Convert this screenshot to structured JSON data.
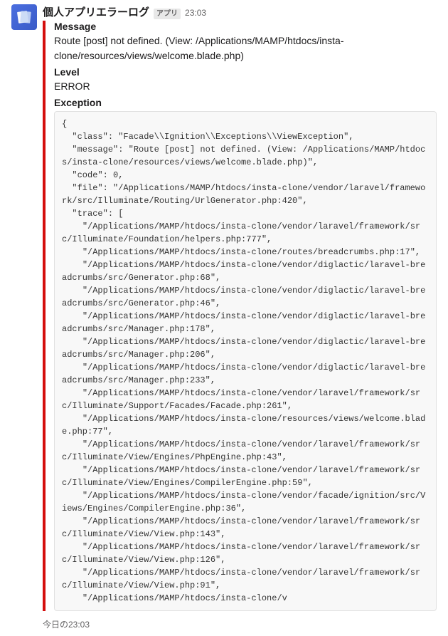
{
  "header": {
    "app_name": "個人アプリエラーログ",
    "app_badge": "アプリ",
    "timestamp": "23:03"
  },
  "attachment": {
    "fields": {
      "message": {
        "label": "Message",
        "value": "Route [post] not defined. (View: /Applications/MAMP/htdocs/insta-clone/resources/views/welcome.blade.php)"
      },
      "level": {
        "label": "Level",
        "value": "ERROR"
      },
      "exception": {
        "label": "Exception",
        "code": "{\n  \"class\": \"Facade\\\\Ignition\\\\Exceptions\\\\ViewException\",\n  \"message\": \"Route [post] not defined. (View: /Applications/MAMP/htdocs/insta-clone/resources/views/welcome.blade.php)\",\n  \"code\": 0,\n  \"file\": \"/Applications/MAMP/htdocs/insta-clone/vendor/laravel/framework/src/Illuminate/Routing/UrlGenerator.php:420\",\n  \"trace\": [\n    \"/Applications/MAMP/htdocs/insta-clone/vendor/laravel/framework/src/Illuminate/Foundation/helpers.php:777\",\n    \"/Applications/MAMP/htdocs/insta-clone/routes/breadcrumbs.php:17\",\n    \"/Applications/MAMP/htdocs/insta-clone/vendor/diglactic/laravel-breadcrumbs/src/Generator.php:68\",\n    \"/Applications/MAMP/htdocs/insta-clone/vendor/diglactic/laravel-breadcrumbs/src/Generator.php:46\",\n    \"/Applications/MAMP/htdocs/insta-clone/vendor/diglactic/laravel-breadcrumbs/src/Manager.php:178\",\n    \"/Applications/MAMP/htdocs/insta-clone/vendor/diglactic/laravel-breadcrumbs/src/Manager.php:206\",\n    \"/Applications/MAMP/htdocs/insta-clone/vendor/diglactic/laravel-breadcrumbs/src/Manager.php:233\",\n    \"/Applications/MAMP/htdocs/insta-clone/vendor/laravel/framework/src/Illuminate/Support/Facades/Facade.php:261\",\n    \"/Applications/MAMP/htdocs/insta-clone/resources/views/welcome.blade.php:77\",\n    \"/Applications/MAMP/htdocs/insta-clone/vendor/laravel/framework/src/Illuminate/View/Engines/PhpEngine.php:43\",\n    \"/Applications/MAMP/htdocs/insta-clone/vendor/laravel/framework/src/Illuminate/View/Engines/CompilerEngine.php:59\",\n    \"/Applications/MAMP/htdocs/insta-clone/vendor/facade/ignition/src/Views/Engines/CompilerEngine.php:36\",\n    \"/Applications/MAMP/htdocs/insta-clone/vendor/laravel/framework/src/Illuminate/View/View.php:143\",\n    \"/Applications/MAMP/htdocs/insta-clone/vendor/laravel/framework/src/Illuminate/View/View.php:126\",\n    \"/Applications/MAMP/htdocs/insta-clone/vendor/laravel/framework/src/Illuminate/View/View.php:91\",\n    \"/Applications/MAMP/htdocs/insta-clone/v"
      }
    }
  },
  "footer": {
    "timestamp": "今日の23:03"
  }
}
